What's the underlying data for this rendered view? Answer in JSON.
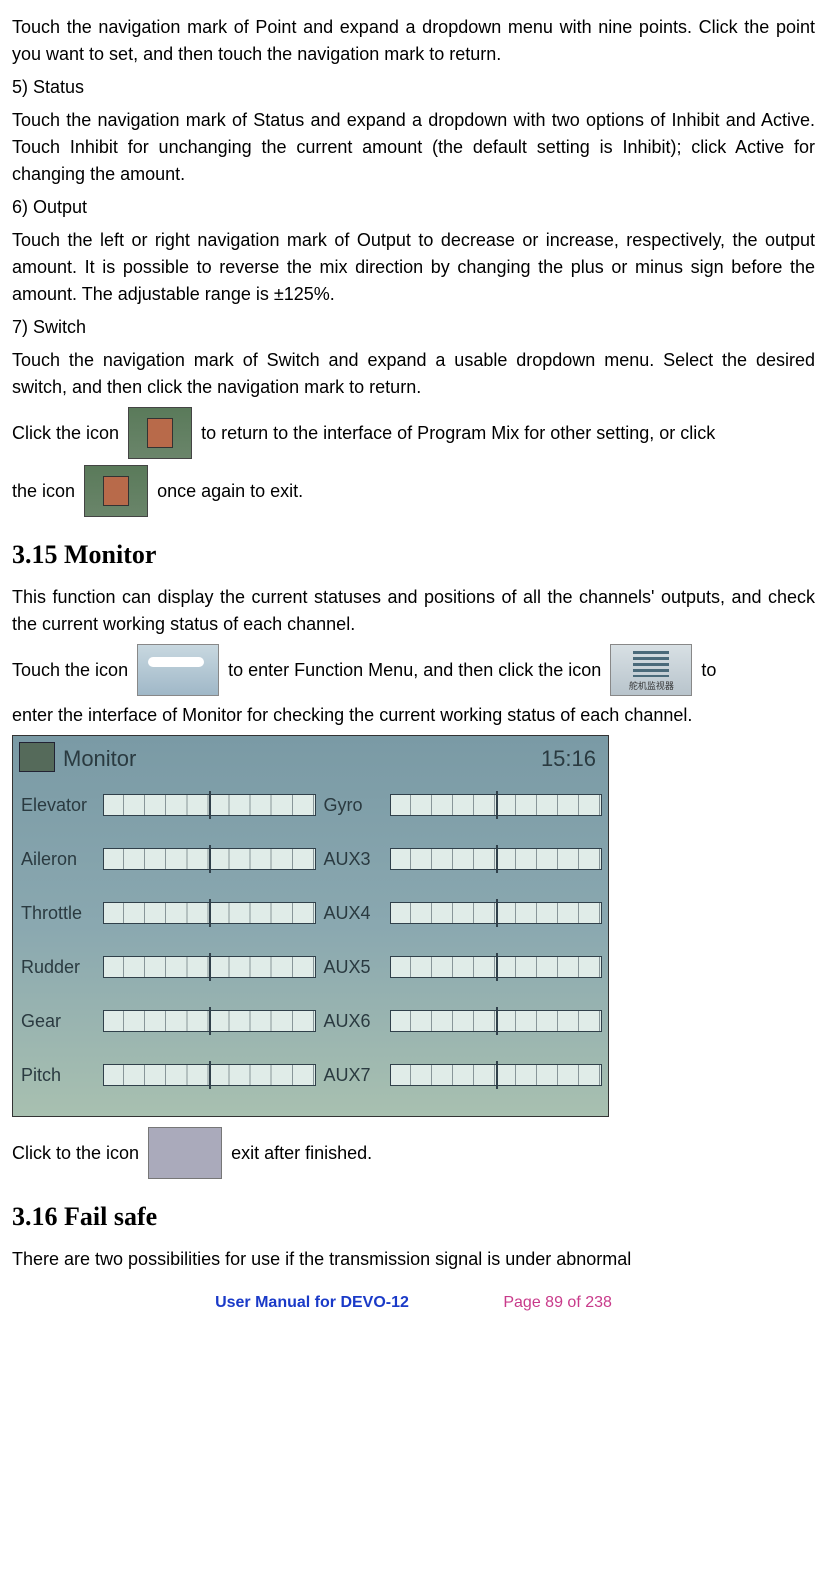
{
  "para_point_intro": "Touch the navigation mark of Point and expand a dropdown menu with nine points. Click the point you want to set, and then touch the navigation mark to return.",
  "item5_label": "5)  Status",
  "para_status": "Touch the navigation mark of Status and expand a dropdown with two options of Inhibit and Active. Touch Inhibit for unchanging the current amount (the default setting is Inhibit); click Active for changing the amount.",
  "item6_label": "6)  Output",
  "para_output": "Touch the left or right navigation mark of Output to decrease or increase, respectively, the output amount. It is possible to reverse the mix direction by changing the plus or minus sign before the amount. The adjustable range is ±125%.",
  "item7_label": "7)  Switch",
  "para_switch": "Touch the navigation mark of Switch and expand a usable dropdown menu. Select the desired switch, and then click the navigation mark to return.",
  "click_icon_prefix": "Click the icon ",
  "click_return_suffix": " to return to the interface of Program Mix for other setting, or click ",
  "the_icon_prefix": "the icon ",
  "once_again_suffix": " once again to exit.",
  "h_monitor": "3.15 Monitor",
  "para_monitor_intro": "This function can display the current statuses and positions of all the channels' outputs, and check the current working status of each channel.",
  "touch_icon_prefix": "Touch the icon ",
  "enter_func_mid": " to enter Function Menu, and then click the icon ",
  "enter_monitor_suffix": " to ",
  "para_monitor_cont": "enter the interface of Monitor for checking the current working status of each channel.",
  "screenshot": {
    "title": "Monitor",
    "time": "15:16",
    "channels_left": [
      "Elevator",
      "Aileron",
      "Throttle",
      "Rudder",
      "Gear",
      "Pitch"
    ],
    "channels_right": [
      "Gyro",
      "AUX3",
      "AUX4",
      "AUX5",
      "AUX6",
      "AUX7"
    ]
  },
  "monitor_icon_label": "舵机监视器",
  "click_exit_prefix": "Click to the icon ",
  "click_exit_suffix": " exit after finished.",
  "h_failsafe": "3.16 Fail safe",
  "para_failsafe": "There are two possibilities for use if the transmission signal is under abnormal",
  "footer_left": "User Manual for DEVO-12",
  "footer_right": "Page 89 of 238"
}
